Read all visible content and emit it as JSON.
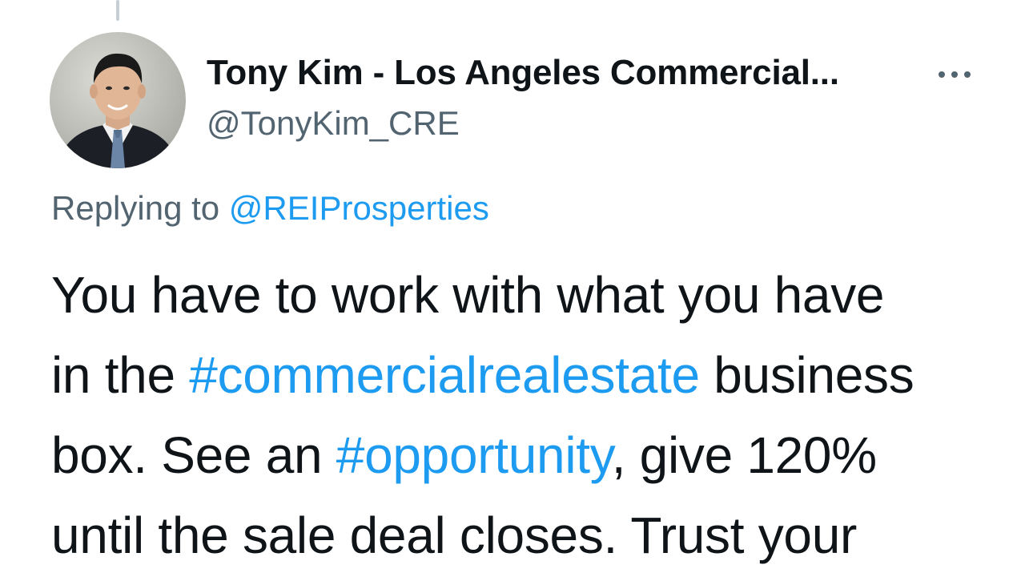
{
  "tweet": {
    "author": {
      "name": "Tony Kim - Los Angeles Commercial...",
      "handle": "@TonyKim_CRE",
      "avatar_icon": "profile-photo"
    },
    "more_icon": "more-horizontal-icon",
    "reply_context": {
      "prefix": "Replying to ",
      "mention": "@REIProsperties"
    },
    "body": {
      "line1": "You have to work with what you have",
      "line2_prefix": "in the ",
      "hashtag_1": "#commercialrealestate",
      "line2_suffix": " business",
      "line3_prefix": "box. See an ",
      "hashtag_2": "#opportunity",
      "line3_suffix": ", give 120%",
      "line4": "until the sale deal closes. Trust your"
    }
  },
  "colors": {
    "link": "#1d9bf0",
    "secondary_text": "#536471",
    "primary_text": "#0f1419"
  }
}
